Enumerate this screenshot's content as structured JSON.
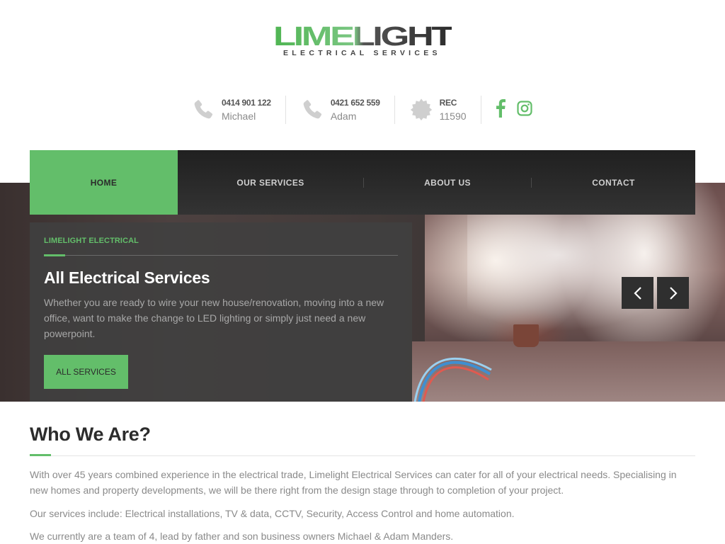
{
  "brand": {
    "logo_text": "LIMELIGHT",
    "tagline": "ELECTRICAL SERVICES"
  },
  "contacts": [
    {
      "icon": "phone-icon",
      "number": "0414 901 122",
      "name": "Michael"
    },
    {
      "icon": "phone-icon",
      "number": "0421 652 559",
      "name": "Adam"
    },
    {
      "icon": "badge-icon",
      "number": "REC",
      "name": "11590"
    }
  ],
  "social": [
    "facebook-icon",
    "instagram-icon"
  ],
  "nav": {
    "items": [
      {
        "label": "HOME",
        "active": true
      },
      {
        "label": "OUR SERVICES",
        "active": false
      },
      {
        "label": "ABOUT US",
        "active": false
      },
      {
        "label": "CONTACT",
        "active": false
      }
    ]
  },
  "hero": {
    "eyebrow": "LIMELIGHT ELECTRICAL",
    "title": "All Electrical Services",
    "description": "Whether you are ready to wire your new house/renovation, moving into a new office, want to make the change to LED lighting or simply just need a new powerpoint.",
    "button_label": "ALL SERVICES",
    "prev_icon": "chevron-left-icon",
    "next_icon": "chevron-right-icon"
  },
  "about": {
    "title": "Who We Are?",
    "paragraphs": [
      "With over 45 years combined experience in the electrical trade, Limelight Electrical Services can cater for all of your electrical needs. Specialising in new homes and property developments, we will be there right from the design stage through to completion of your project.",
      "Our services include: Electrical installations, TV & data, CCTV, Security, Access Control and home automation.",
      "We currently are a team of 4, lead by father and son business owners Michael & Adam Manders."
    ]
  },
  "colors": {
    "accent": "#63be6a",
    "nav_bg": "#2a2a2a",
    "heading": "#2c2c2c",
    "body_text": "#8a8a8a"
  }
}
